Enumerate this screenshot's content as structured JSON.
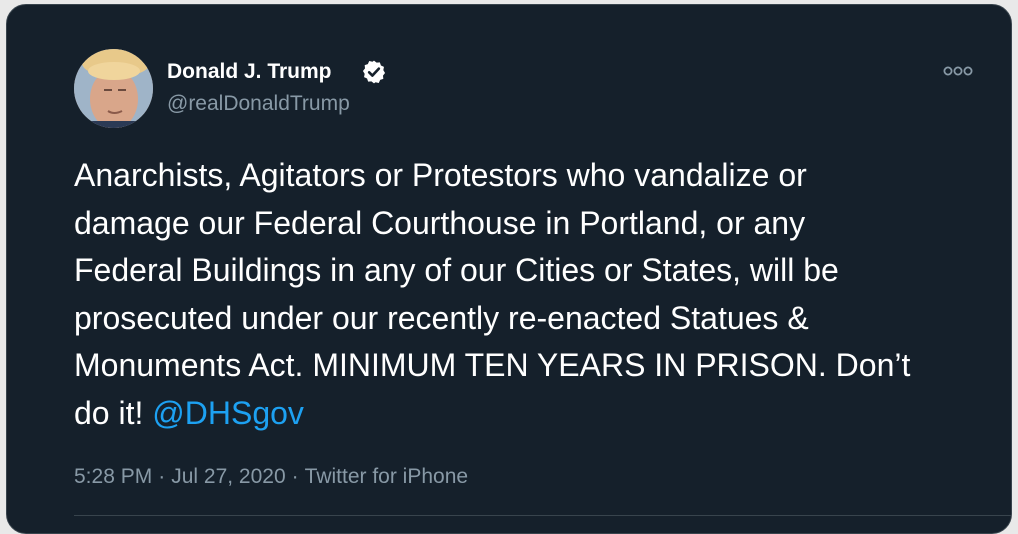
{
  "tweet": {
    "author": {
      "name": "Donald J. Trump",
      "handle": "@realDonaldTrump",
      "verified": true,
      "avatar_icon": "profile-photo"
    },
    "text_lines": [
      "Anarchists, Agitators or Protestors who vandalize or",
      "damage our Federal Courthouse in Portland, or any",
      "Federal Buildings in any of our Cities or States, will be",
      "prosecuted under our recently re-enacted Statues &",
      "Monuments Act. MINIMUM TEN YEARS IN PRISON. Don’t"
    ],
    "last_line_text": "do it! ",
    "mention": "@DHSgov",
    "time": "5:28 PM",
    "date": "Jul 27, 2020",
    "source": "Twitter for iPhone",
    "separator": "·"
  },
  "icons": {
    "more": "more-options-icon",
    "verified": "verified-badge-icon"
  },
  "colors": {
    "background": "#15202b",
    "border": "#38444d",
    "text_primary": "#ffffff",
    "text_secondary": "#8899a6",
    "link": "#1da1f2"
  }
}
